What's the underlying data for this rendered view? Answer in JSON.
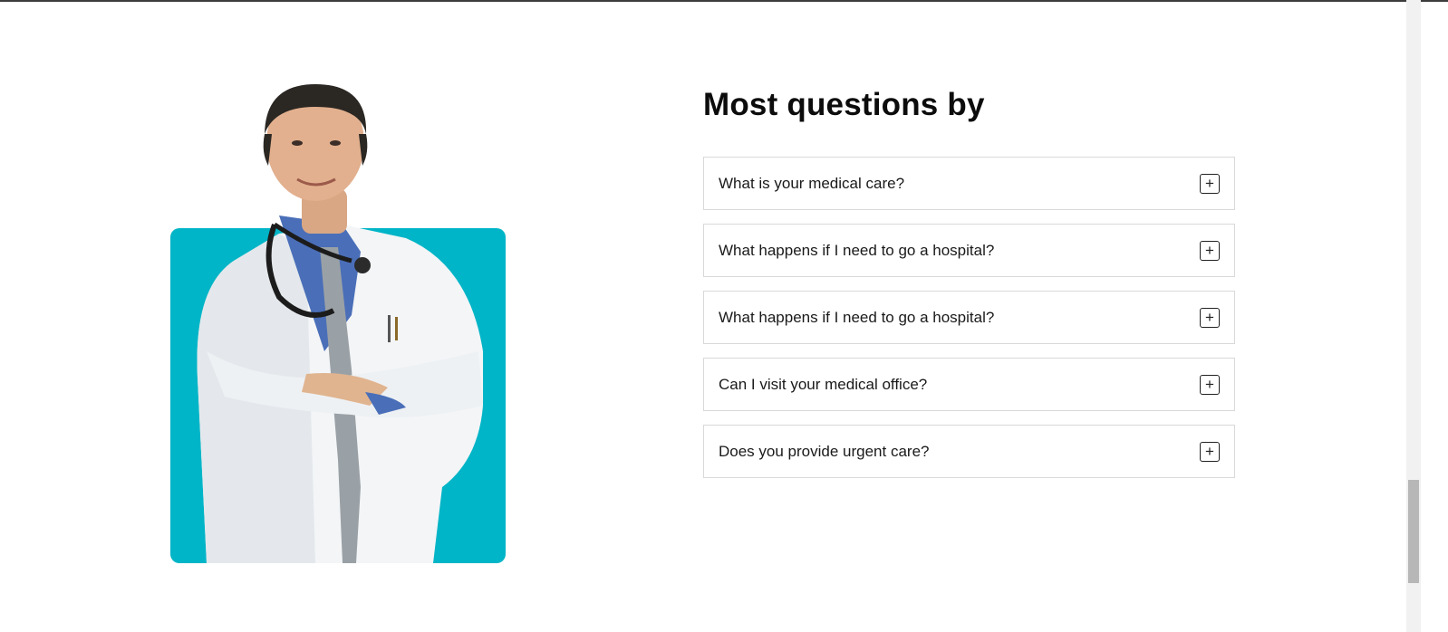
{
  "faq": {
    "title": "Most questions by",
    "items": [
      {
        "question": "What is your medical care?",
        "toggle": "+"
      },
      {
        "question": "What happens if I need to go a hospital?",
        "toggle": "+"
      },
      {
        "question": "What happens if I need to go a hospital?",
        "toggle": "+"
      },
      {
        "question": "Can I visit your medical office?",
        "toggle": "+"
      },
      {
        "question": "Does you provide urgent care?",
        "toggle": "+"
      }
    ]
  },
  "colors": {
    "accent_teal": "#00b5c7",
    "border": "#d9d9d9",
    "text": "#1a1a1a"
  },
  "icons": [
    "plus-icon"
  ]
}
